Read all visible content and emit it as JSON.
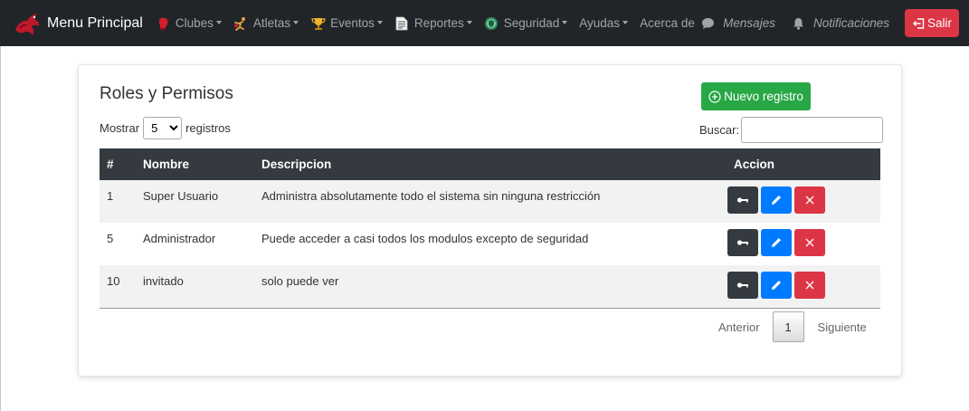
{
  "navbar": {
    "brand": "Menu Principal",
    "items": [
      {
        "label": "Clubes",
        "icon": "boxing-glove-icon",
        "dropdown": true
      },
      {
        "label": "Atletas",
        "icon": "athlete-icon",
        "dropdown": true
      },
      {
        "label": "Eventos",
        "icon": "trophy-icon",
        "dropdown": true
      },
      {
        "label": "Reportes",
        "icon": "report-icon",
        "dropdown": true
      },
      {
        "label": "Seguridad",
        "icon": "shield-icon",
        "dropdown": true
      },
      {
        "label": "Ayudas",
        "dropdown": true
      },
      {
        "label": "Acerca de",
        "dropdown": false
      }
    ],
    "right": {
      "mensajes": "Mensajes",
      "notificaciones": "Notificaciones",
      "salir": "Salir"
    }
  },
  "card": {
    "title": "Roles y Permisos",
    "new_button": "Nuevo registro",
    "length": {
      "prefix": "Mostrar",
      "value": "5",
      "suffix": "registros"
    },
    "search_label": "Buscar:",
    "search_value": ""
  },
  "table": {
    "columns": [
      "#",
      "Nombre",
      "Descripcion",
      "Accion"
    ],
    "rows": [
      {
        "id": "1",
        "nombre": "Super Usuario",
        "descripcion": "Administra absolutamente todo el sistema sin ninguna restricción"
      },
      {
        "id": "5",
        "nombre": "Administrador",
        "descripcion": "Puede acceder a casi todos los modulos excepto de seguridad"
      },
      {
        "id": "10",
        "nombre": "invitado",
        "descripcion": "solo puede ver"
      }
    ]
  },
  "pagination": {
    "prev": "Anterior",
    "current": "1",
    "next": "Siguiente"
  },
  "colors": {
    "navbar": "#212529",
    "table_header": "#343a40",
    "success": "#28a745",
    "primary": "#007bff",
    "danger": "#dc3545"
  }
}
